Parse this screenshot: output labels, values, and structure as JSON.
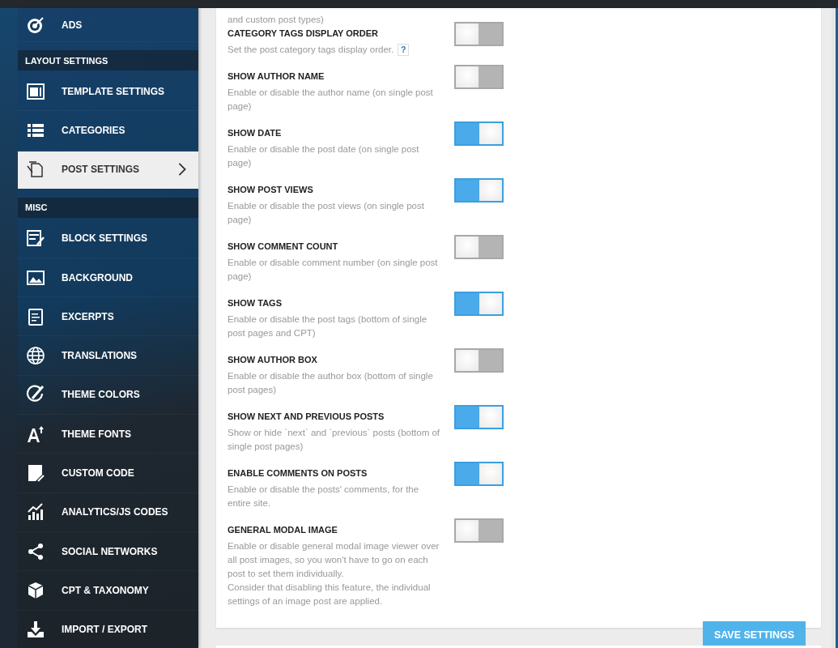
{
  "sidebar": {
    "items": [
      {
        "kind": "item",
        "label": "ADS",
        "selected": false
      },
      {
        "kind": "header",
        "label": "LAYOUT SETTINGS"
      },
      {
        "kind": "item",
        "label": "TEMPLATE SETTINGS",
        "selected": false
      },
      {
        "kind": "item",
        "label": "CATEGORIES",
        "selected": false
      },
      {
        "kind": "item",
        "label": "POST SETTINGS",
        "selected": true
      },
      {
        "kind": "header",
        "label": "MISC"
      },
      {
        "kind": "item",
        "label": "BLOCK SETTINGS",
        "selected": false
      },
      {
        "kind": "item",
        "label": "BACKGROUND",
        "selected": false
      },
      {
        "kind": "item",
        "label": "EXCERPTS",
        "selected": false
      },
      {
        "kind": "item",
        "label": "TRANSLATIONS",
        "selected": false
      },
      {
        "kind": "item",
        "label": "THEME COLORS",
        "selected": false
      },
      {
        "kind": "item",
        "label": "THEME FONTS",
        "selected": false
      },
      {
        "kind": "item",
        "label": "CUSTOM CODE",
        "selected": false
      },
      {
        "kind": "item",
        "label": "ANALYTICS/JS CODES",
        "selected": false
      },
      {
        "kind": "item",
        "label": "SOCIAL NETWORKS",
        "selected": false
      },
      {
        "kind": "item",
        "label": "CPT & TAXONOMY",
        "selected": false
      },
      {
        "kind": "item",
        "label": "IMPORT / EXPORT",
        "selected": false
      }
    ]
  },
  "settings": {
    "partial_description": "and custom post types)",
    "rows": [
      {
        "title": "CATEGORY TAGS DISPLAY ORDER",
        "description": "Set the post category tags display order.",
        "help": "?",
        "on": false
      },
      {
        "title": "SHOW AUTHOR NAME",
        "description": "Enable or disable the author name (on single post page)",
        "on": false
      },
      {
        "title": "SHOW DATE",
        "description": "Enable or disable the post date (on single post page)",
        "on": true
      },
      {
        "title": "SHOW POST VIEWS",
        "description": "Enable or disable the post views (on single post page)",
        "on": true
      },
      {
        "title": "SHOW COMMENT COUNT",
        "description": "Enable or disable comment number (on single post page)",
        "on": false
      },
      {
        "title": "SHOW TAGS",
        "description": "Enable or disable the post tags (bottom of single post pages and CPT)",
        "on": true
      },
      {
        "title": "SHOW AUTHOR BOX",
        "description": "Enable or disable the author box (bottom of single post pages)",
        "on": false
      },
      {
        "title": "SHOW NEXT AND PREVIOUS POSTS",
        "description": "Show or hide `next` and `previous` posts (bottom of single post pages)",
        "on": true
      },
      {
        "title": "ENABLE COMMENTS ON POSTS",
        "description": "Enable or disable the posts' comments, for the entire site.",
        "on": true
      },
      {
        "title": "GENERAL MODAL IMAGE",
        "description": "Enable or disable general modal image viewer over all post images, so you won't have to go on each post to set them individually.",
        "note": "Consider that disabling this feature, the individual settings of an image post are applied.",
        "on": false
      }
    ],
    "save_button": "SAVE SETTINGS"
  }
}
